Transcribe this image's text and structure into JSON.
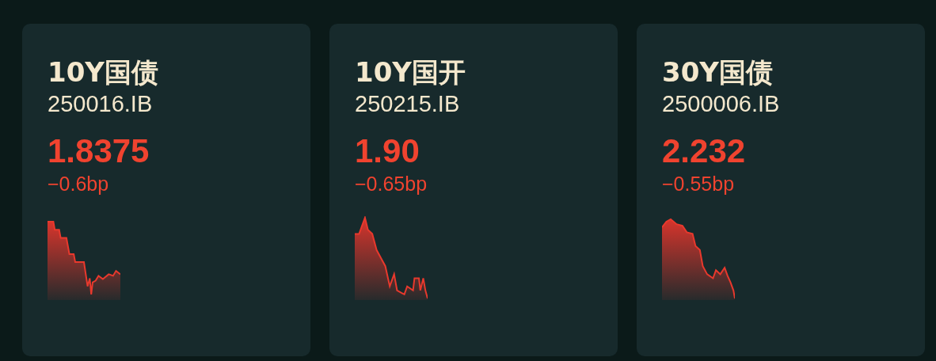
{
  "cards": [
    {
      "name": "10Y国债",
      "code": "250016.IB",
      "yield": "1.8375",
      "change": "−0.6bp"
    },
    {
      "name": "10Y国开",
      "code": "250215.IB",
      "yield": "1.90",
      "change": "−0.65bp"
    },
    {
      "name": "30Y国债",
      "code": "2500006.IB",
      "yield": "2.232",
      "change": "−0.55bp"
    }
  ]
}
